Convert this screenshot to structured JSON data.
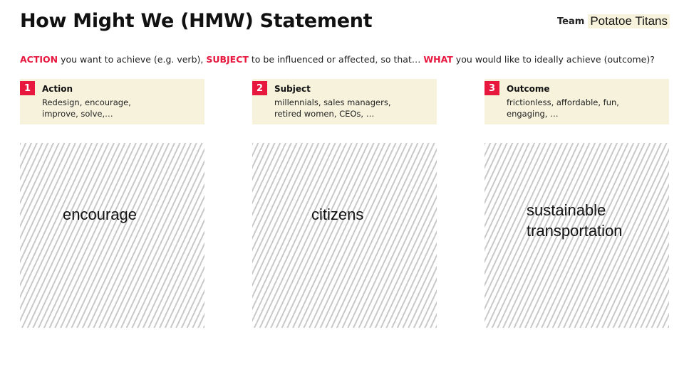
{
  "title": "How Might We (HMW) Statement",
  "team": {
    "label": "Team",
    "name": "Potatoe Titans"
  },
  "prompt": {
    "action_kw": "ACTION",
    "part1": " you want to achieve (e.g. verb), ",
    "subject_kw": "SUBJECT",
    "part2": " to be influenced or affected, so that… ",
    "what_kw": "WHAT",
    "part3": " you would like to ideally achieve (outcome)?"
  },
  "columns": [
    {
      "number": "1",
      "title": "Action",
      "desc_line1": "Redesign, encourage,",
      "desc_line2": "improve, solve,…",
      "answer_line1": "encourage",
      "answer_line2": ""
    },
    {
      "number": "2",
      "title": "Subject",
      "desc_line1": "millennials, sales managers,",
      "desc_line2": "retired women, CEOs, …",
      "answer_line1": "citizens",
      "answer_line2": ""
    },
    {
      "number": "3",
      "title": "Outcome",
      "desc_line1": "frictionless, affordable, fun,",
      "desc_line2": "engaging, …",
      "answer_line1": "sustainable",
      "answer_line2": "transportation"
    }
  ],
  "colors": {
    "accent": "#e8173e",
    "card_bg": "#f6f2dc",
    "hatch_line": "#c9c9c9"
  }
}
